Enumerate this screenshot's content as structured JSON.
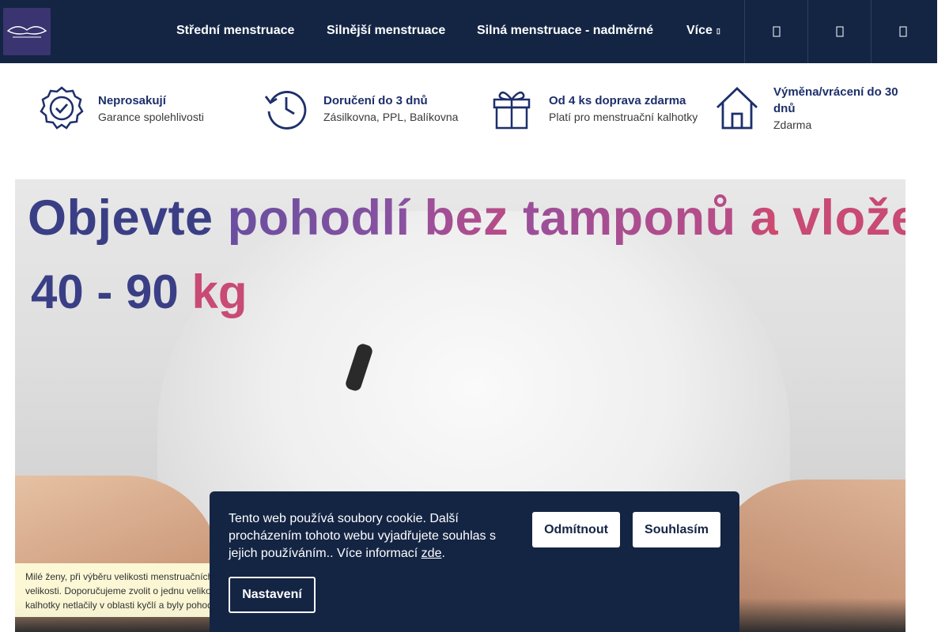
{
  "header": {
    "nav": [
      {
        "label": "Střední menstruace"
      },
      {
        "label": "Silnější menstruace"
      },
      {
        "label": "Silná menstruace - nadměrné"
      },
      {
        "label": "Více"
      }
    ],
    "icons": [
      "search-icon",
      "user-icon",
      "cart-icon"
    ]
  },
  "benefits": [
    {
      "icon": "badge-check-icon",
      "title": "Neprosakují",
      "subtitle": "Garance spolehlivosti"
    },
    {
      "icon": "history-clock-icon",
      "title": "Doručení do 3 dnů",
      "subtitle": "Zásilkovna, PPL, Balíkovna"
    },
    {
      "icon": "gift-icon",
      "title": "Od 4 ks doprava zdarma",
      "subtitle": "Platí pro menstruační kalhotky"
    },
    {
      "icon": "home-icon",
      "title": "Výměna/vrácení do 30 dnů",
      "subtitle": "Zdarma"
    }
  ],
  "hero": {
    "headline_1": "Objevte",
    "headline_2": "pohodlí",
    "headline_3": "bez",
    "headline_4": "tamponů",
    "headline_5": "a",
    "headline_6": "vložek",
    "weight_range": "40 - 90",
    "weight_unit": "kg"
  },
  "size_note": {
    "line1": "Milé ženy, při výběru velikosti menstruačních",
    "line2": "velikosti. Doporučujeme zvolit o jednu veliko",
    "line3": "kalhotky netlačily v oblasti kyčlí a byly pohod"
  },
  "cookie": {
    "text": "Tento web používá soubory cookie. Další procházením tohoto webu vyjadřujete souhlas s jejich používáním.. Více informací",
    "link": "zde",
    "after_link": ".",
    "reject_label": "Odmítnout",
    "accept_label": "Souhlasím",
    "settings_label": "Nastavení"
  },
  "colors": {
    "header_bg": "#142544",
    "accent_blue": "#1d2f6b",
    "hero_text": "#3a3f85",
    "hero_accent": "#c84a75"
  }
}
